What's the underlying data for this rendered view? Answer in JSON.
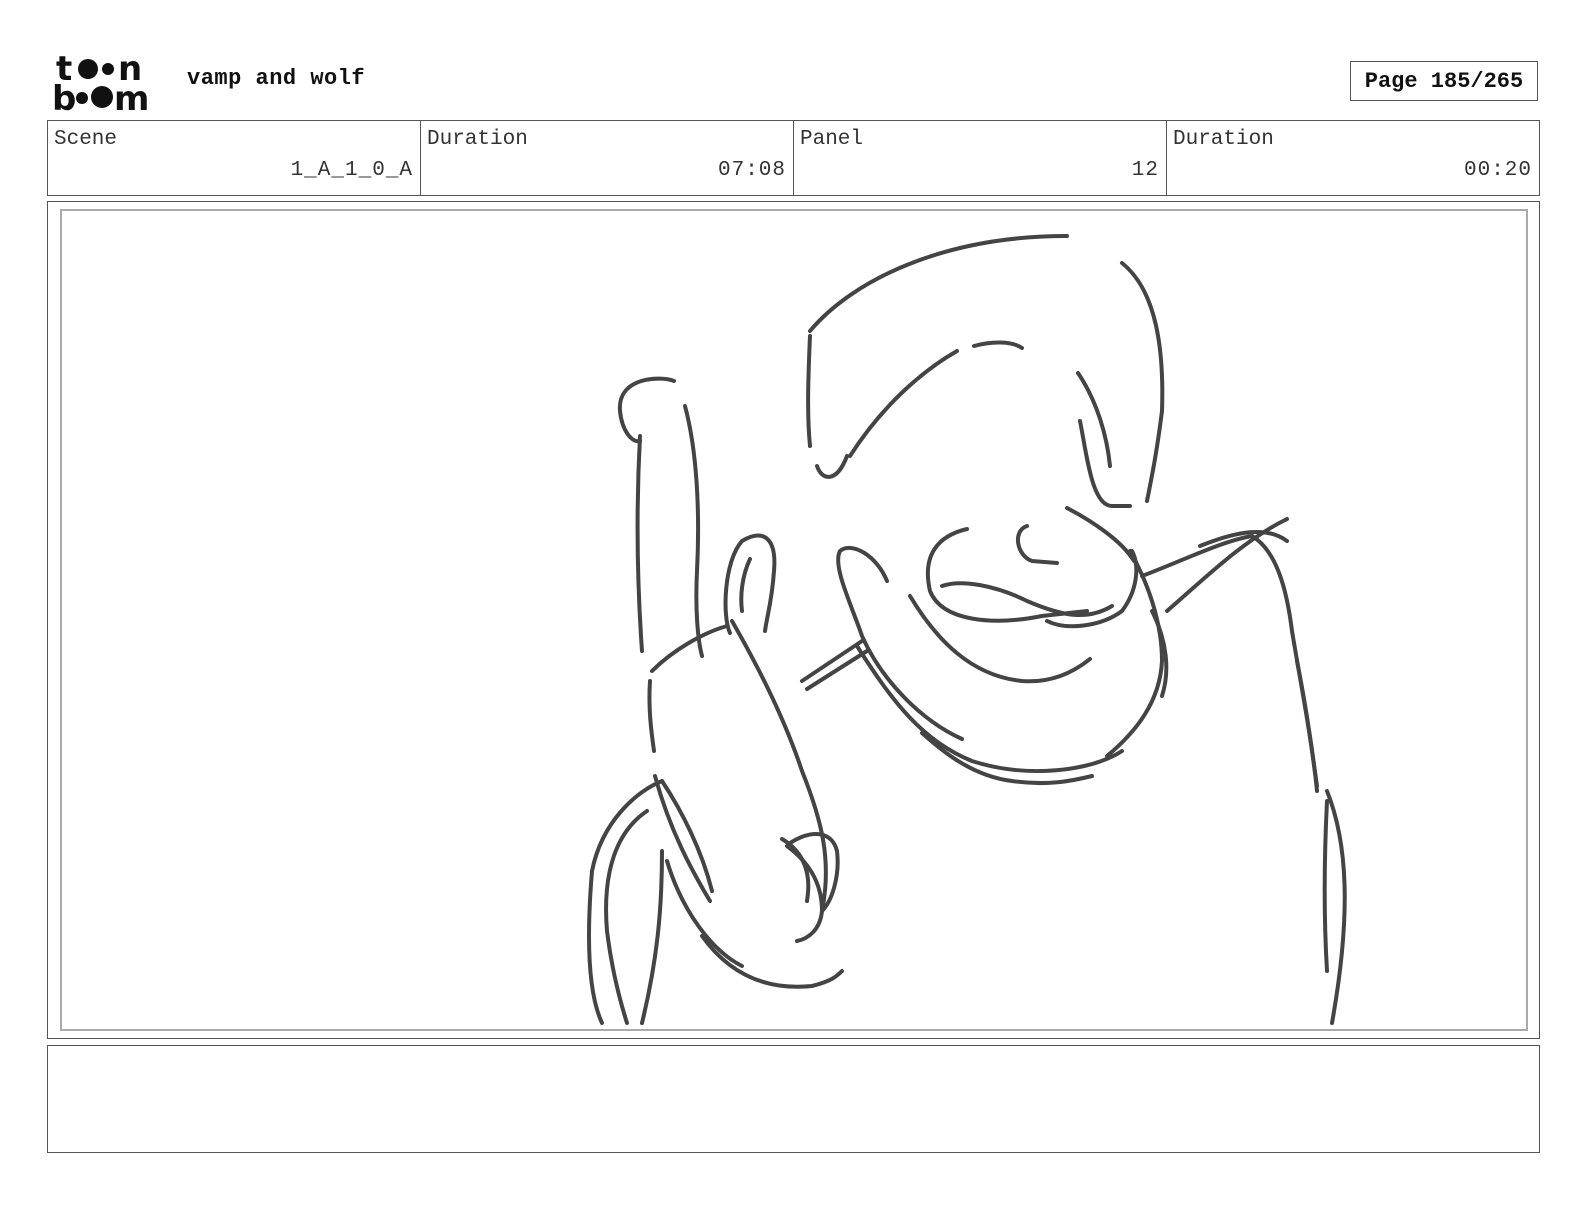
{
  "header": {
    "logo_icon": "toon-boom-logo-icon",
    "project_title": "vamp and wolf",
    "page_label": "Page 185/265"
  },
  "info": {
    "scene_label": "Scene",
    "scene_value": "1_A_1_0_A",
    "scene_duration_label": "Duration",
    "scene_duration_value": "07:08",
    "panel_label": "Panel",
    "panel_value": "12",
    "panel_duration_label": "Duration",
    "panel_duration_value": "00:20"
  },
  "panel": {
    "drawing_icon": "storyboard-sketch-icon",
    "stroke_color": "#444444"
  },
  "caption": {
    "text": ""
  }
}
